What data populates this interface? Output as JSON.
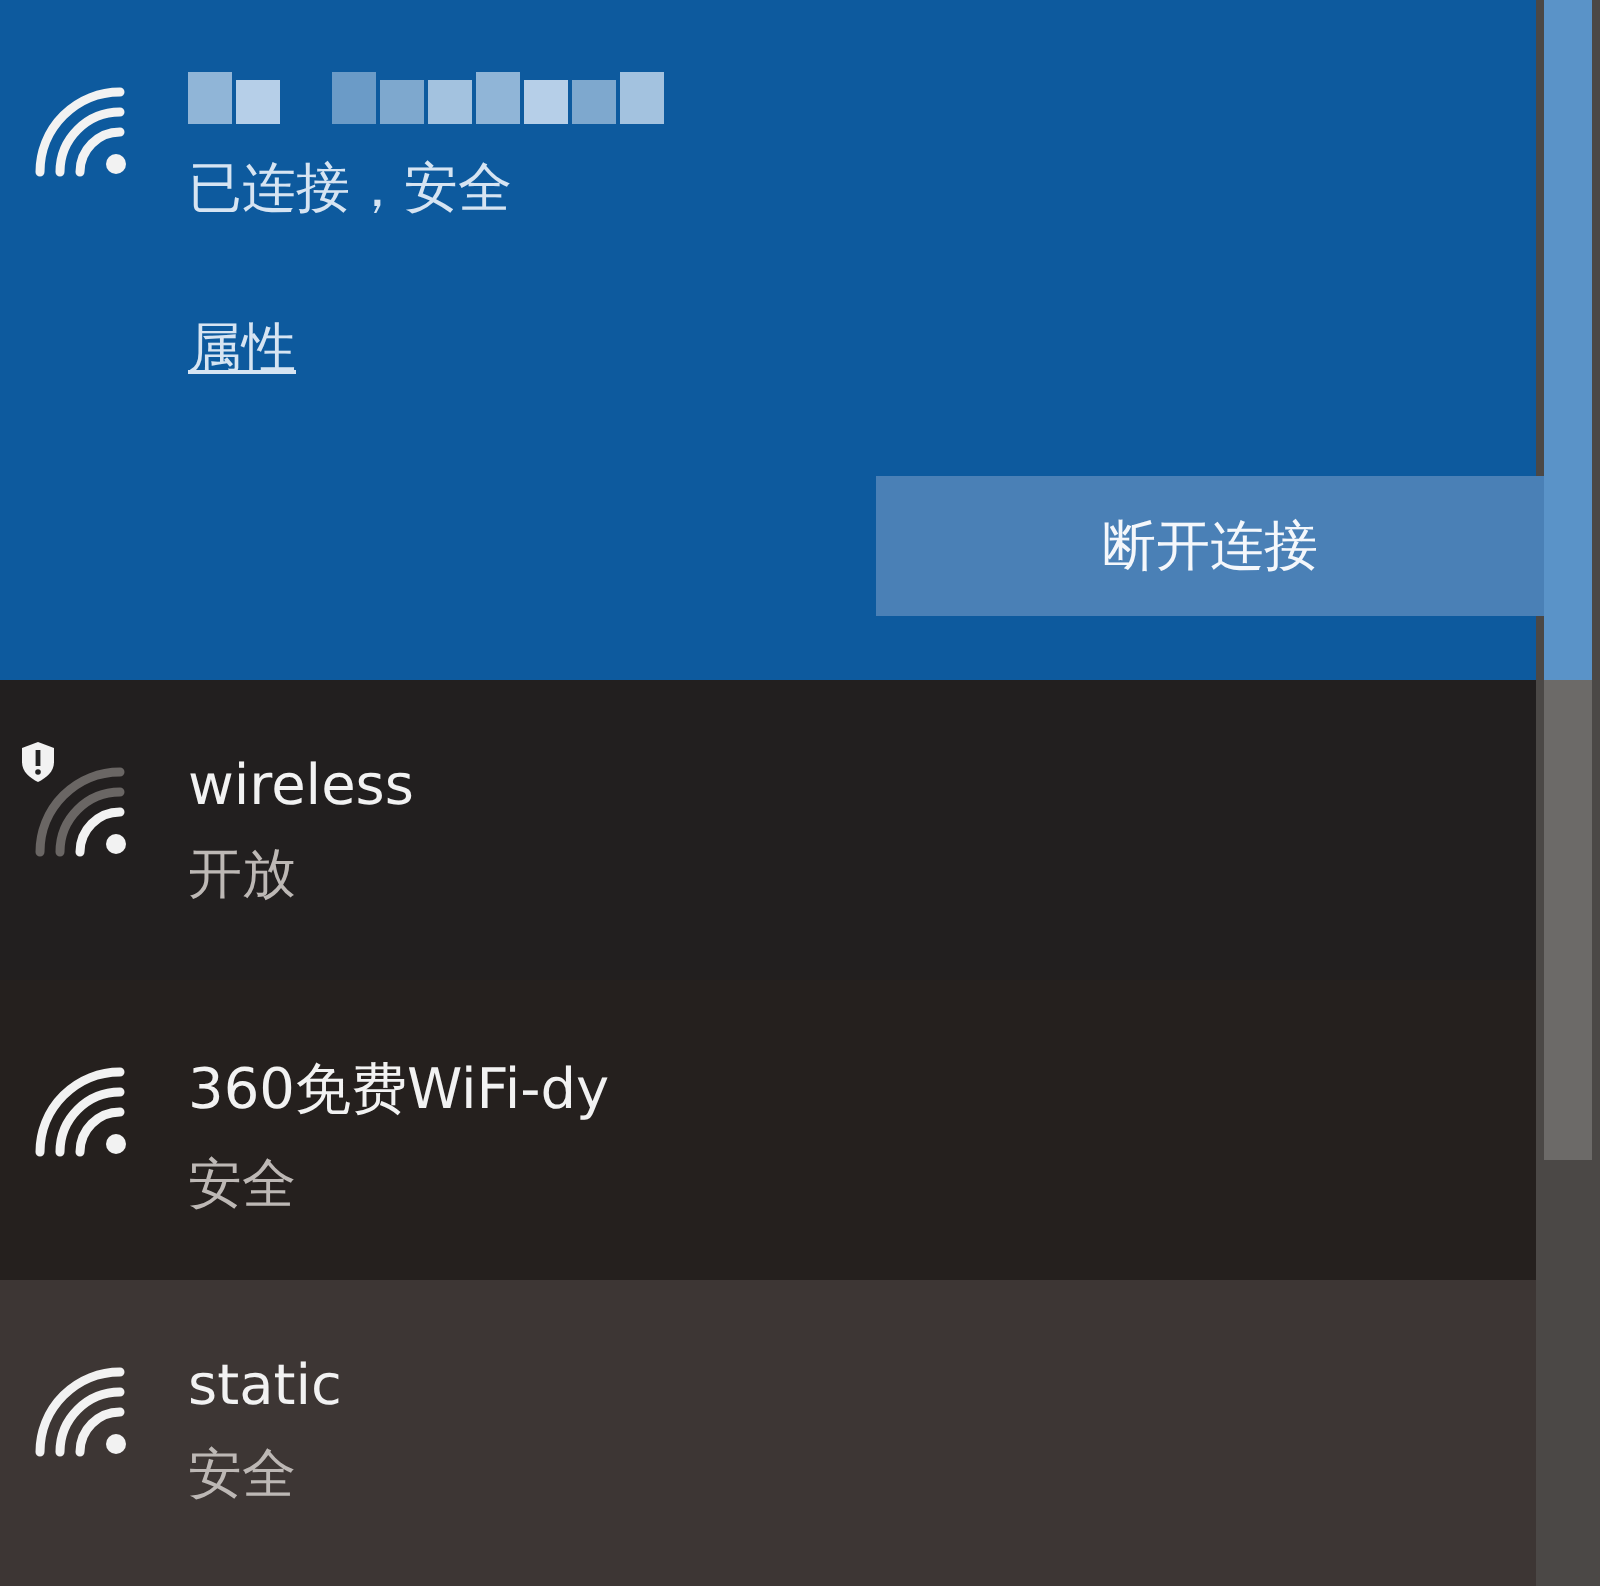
{
  "connected": {
    "status": "已连接，安全",
    "properties_link": "属性",
    "disconnect_button": "断开连接"
  },
  "networks": [
    {
      "name": "wireless",
      "status": "开放",
      "warning": true,
      "hovered": false
    },
    {
      "name": "360免费WiFi-dy",
      "status": "安全",
      "warning": false,
      "hovered": false
    },
    {
      "name": "static",
      "status": "安全",
      "warning": false,
      "hovered": true
    }
  ]
}
